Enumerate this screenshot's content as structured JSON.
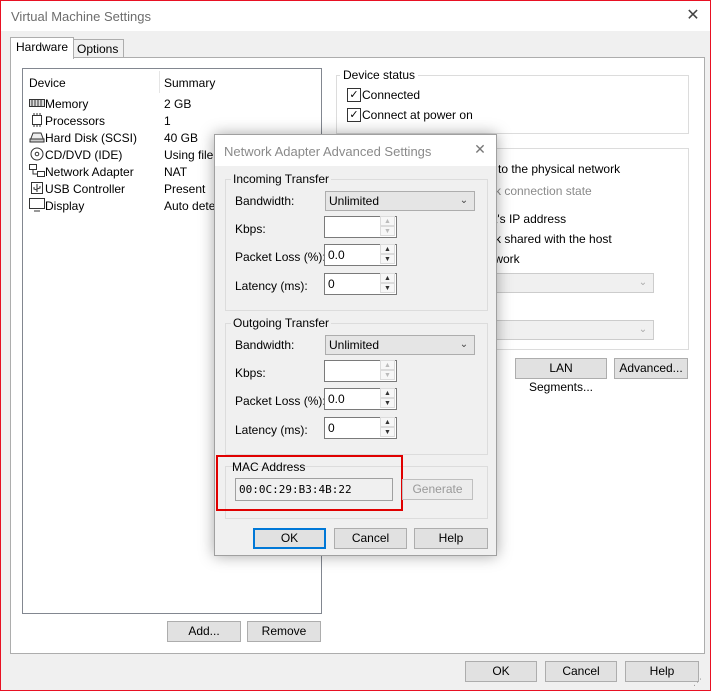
{
  "main_window": {
    "title": "Virtual Machine Settings",
    "tabs": [
      "Hardware",
      "Options"
    ],
    "device_list": {
      "columns": [
        "Device",
        "Summary"
      ],
      "rows": [
        {
          "device": "Memory",
          "summary": "2 GB",
          "icon": "memory-icon"
        },
        {
          "device": "Processors",
          "summary": "1",
          "icon": "processor-icon"
        },
        {
          "device": "Hard Disk (SCSI)",
          "summary": "40 GB",
          "icon": "hard-disk-icon"
        },
        {
          "device": "CD/DVD (IDE)",
          "summary": "Using file D",
          "icon": "cd-dvd-icon"
        },
        {
          "device": "Network Adapter",
          "summary": "NAT",
          "icon": "network-adapter-icon"
        },
        {
          "device": "USB Controller",
          "summary": "Present",
          "icon": "usb-icon"
        },
        {
          "device": "Display",
          "summary": "Auto detec",
          "icon": "display-icon"
        }
      ]
    },
    "add_button": "Add...",
    "remove_button": "Remove",
    "device_status": {
      "label": "Device status",
      "connected": "Connected",
      "connect_at_power_on": "Connect at power on"
    },
    "network_partial": {
      "line1": "to the physical network",
      "line2": "rk connection state",
      "line3": "t's IP address",
      "line4": "rk shared with the host",
      "line5": "twork"
    },
    "lan_segments_button": "LAN Segments...",
    "advanced_button": "Advanced...",
    "ok_button": "OK",
    "cancel_button": "Cancel",
    "help_button": "Help"
  },
  "dialog": {
    "title": "Network Adapter Advanced Settings",
    "incoming": {
      "label": "Incoming Transfer",
      "bandwidth_label": "Bandwidth:",
      "bandwidth_value": "Unlimited",
      "kbps_label": "Kbps:",
      "kbps_value": "",
      "packet_loss_label": "Packet Loss (%):",
      "packet_loss_value": "0.0",
      "latency_label": "Latency (ms):",
      "latency_value": "0"
    },
    "outgoing": {
      "label": "Outgoing Transfer",
      "bandwidth_label": "Bandwidth:",
      "bandwidth_value": "Unlimited",
      "kbps_label": "Kbps:",
      "kbps_value": "",
      "packet_loss_label": "Packet Loss (%):",
      "packet_loss_value": "0.0",
      "latency_label": "Latency (ms):",
      "latency_value": "0"
    },
    "mac": {
      "label": "MAC Address",
      "value": "00:0C:29:B3:4B:22",
      "generate_button": "Generate"
    },
    "ok_button": "OK",
    "cancel_button": "Cancel",
    "help_button": "Help"
  },
  "colors": {
    "window_border": "#e81123",
    "highlight_box": "#e00000",
    "primary_button_border": "#0078d7"
  }
}
